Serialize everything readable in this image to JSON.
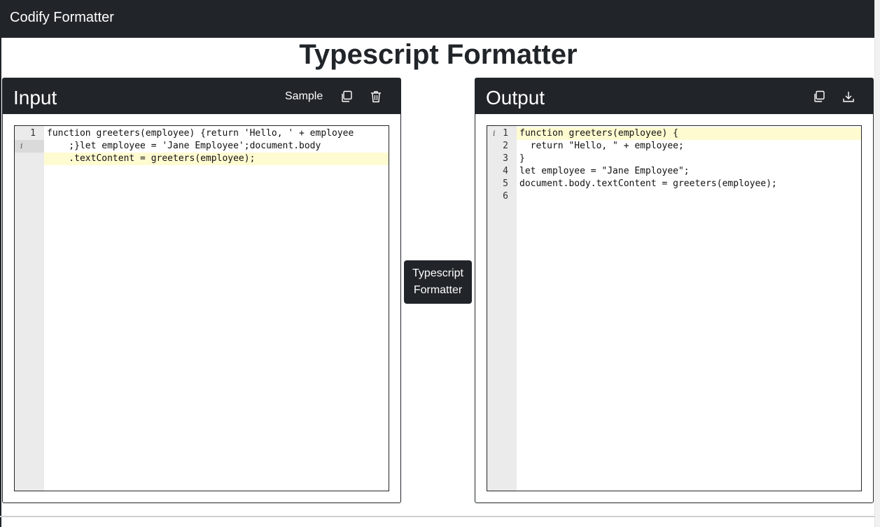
{
  "app": {
    "brand": "Codify Formatter"
  },
  "page": {
    "title": "Typescript Formatter"
  },
  "input_panel": {
    "title": "Input",
    "sample_label": "Sample",
    "copy_icon": "copy-icon",
    "delete_icon": "trash-icon",
    "line_number": "1",
    "info_marker": "i",
    "lines": [
      "function greeters(employee) {return 'Hello, ' + employee",
      "    ;}let employee = 'Jane Employee';document.body",
      "    .textContent = greeters(employee);"
    ]
  },
  "format_button": {
    "line1": "Typescript",
    "line2": "Formatter"
  },
  "output_panel": {
    "title": "Output",
    "copy_icon": "copy-icon",
    "download_icon": "download-icon",
    "info_marker": "i",
    "line_numbers": [
      "1",
      "2",
      "3",
      "4",
      "5",
      "6"
    ],
    "lines": [
      "function greeters(employee) {",
      "  return \"Hello, \" + employee;",
      "}",
      "let employee = \"Jane Employee\";",
      "document.body.textContent = greeters(employee);",
      ""
    ]
  },
  "colors": {
    "dark": "#212529",
    "active_line": "#fffbd1",
    "gutter": "#ebebeb"
  }
}
